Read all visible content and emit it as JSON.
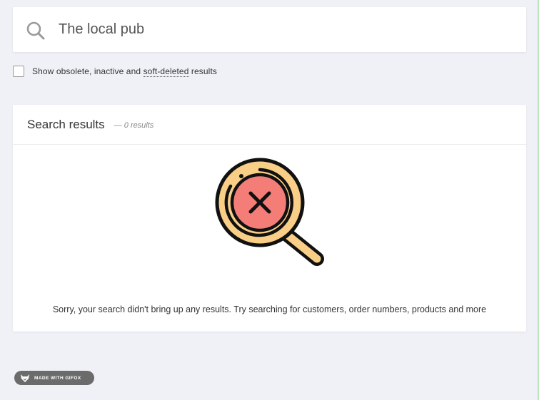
{
  "search": {
    "value": "The local pub",
    "icon": "search-icon"
  },
  "filter": {
    "label_prefix": "Show obsolete, inactive and ",
    "label_link": "soft-deleted",
    "label_suffix": " results",
    "checked": false
  },
  "results": {
    "title": "Search results",
    "count_text": "— 0 results",
    "illustration": "no-results-magnifier-icon",
    "empty_message": "Sorry, your search didn't bring up any results. Try searching for customers, order numbers, products and more"
  },
  "badge": {
    "text": "MADE WITH GIFOX",
    "icon": "fox-icon"
  },
  "colors": {
    "background": "#f0f1f6",
    "magnifier_ring": "#f9cf88",
    "magnifier_center": "#f47d77",
    "outline": "#111111",
    "badge": "#6b6b6b"
  }
}
